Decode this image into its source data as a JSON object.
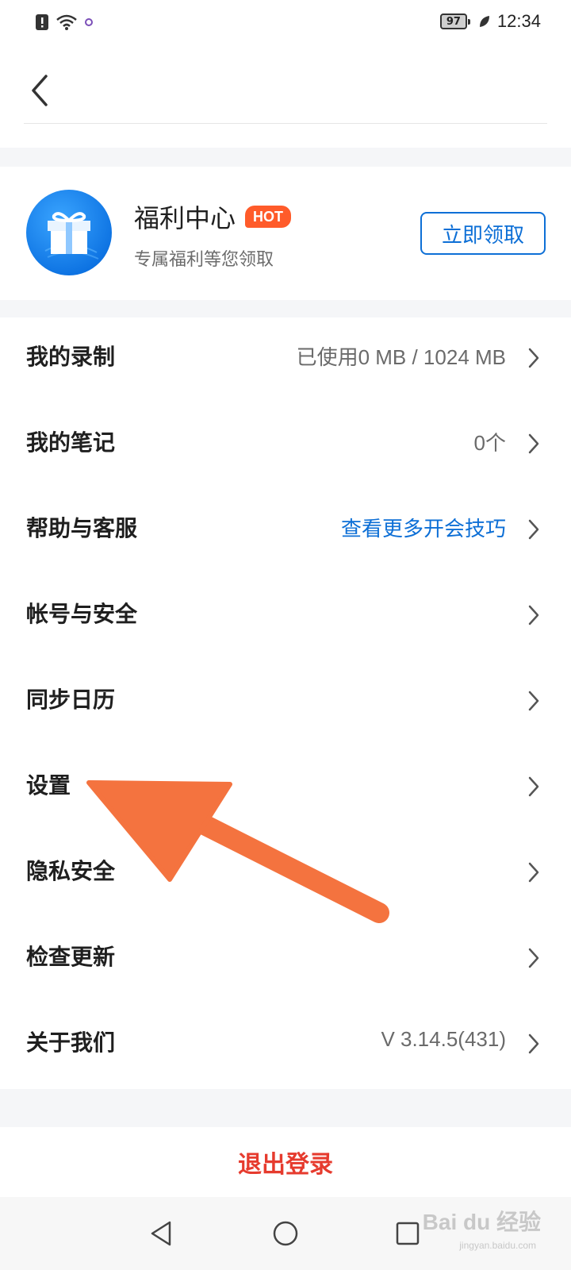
{
  "status_bar": {
    "battery": "97",
    "time": "12:34",
    "icons": [
      "alert-icon",
      "wifi-icon",
      "app-notification-icon",
      "leaf-icon"
    ]
  },
  "header": {
    "back_icon": "chevron-left-icon"
  },
  "promo": {
    "icon": "gift-icon",
    "title": "福利中心",
    "badge": "HOT",
    "subtitle": "专属福利等您领取",
    "button": "立即领取"
  },
  "menu": {
    "items": [
      {
        "label": "我的录制",
        "value": "已使用0 MB / 1024 MB"
      },
      {
        "label": "我的笔记",
        "value": "0个"
      },
      {
        "label": "帮助与客服",
        "value": "查看更多开会技巧"
      },
      {
        "label": "帐号与安全",
        "value": ""
      },
      {
        "label": "同步日历",
        "value": ""
      },
      {
        "label": "设置",
        "value": ""
      },
      {
        "label": "隐私安全",
        "value": ""
      },
      {
        "label": "检查更新",
        "value": ""
      },
      {
        "label": "关于我们",
        "value": "V 3.14.5(431)"
      }
    ]
  },
  "logout": {
    "label": "退出登录"
  },
  "watermark": {
    "text": "Bai du 经验",
    "url": "jingyan.baidu.com"
  },
  "colors": {
    "accent_blue": "#0d6fd6",
    "hot_orange": "#ff5b2a",
    "logout_red": "#e63b2e",
    "arrow_orange": "#f4733f"
  }
}
